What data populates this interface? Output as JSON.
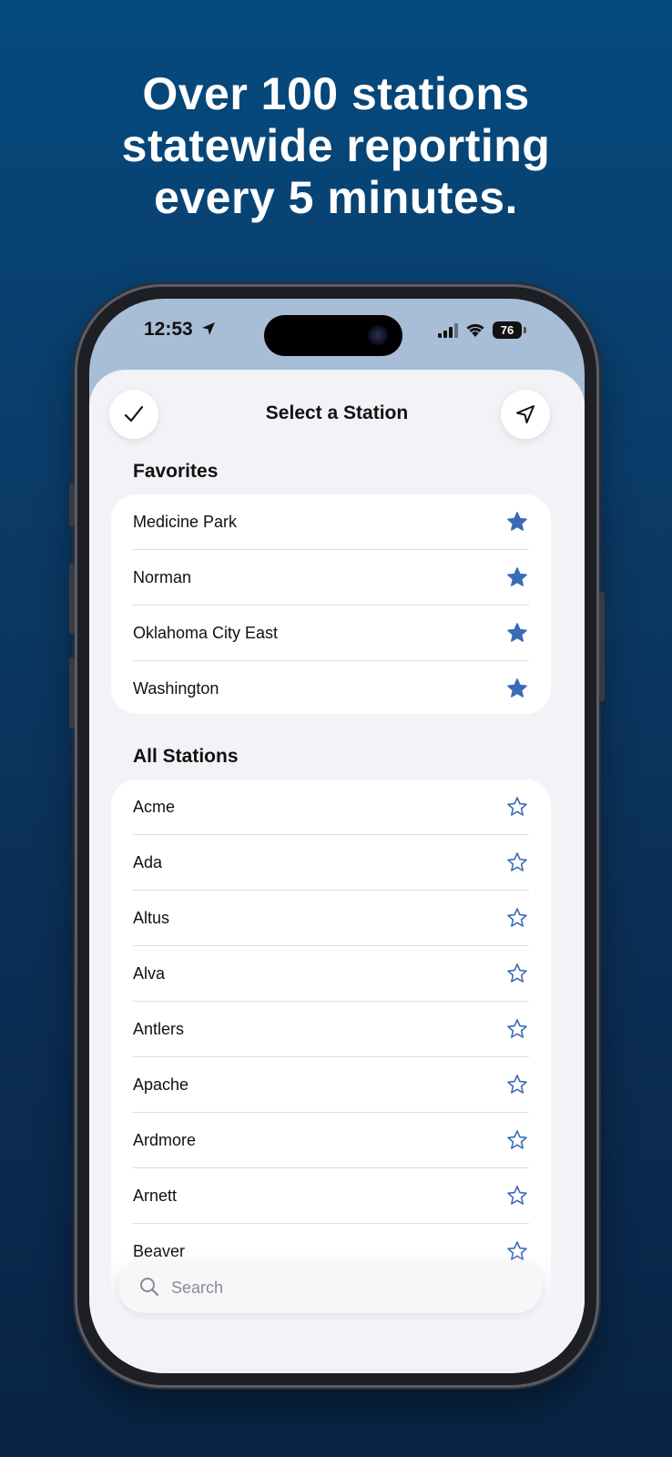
{
  "headline": {
    "line1": "Over 100 stations",
    "line2": "statewide reporting",
    "line3": "every 5 minutes."
  },
  "status_bar": {
    "time": "12:53",
    "battery": "76",
    "icons": [
      "location-arrow-icon",
      "signal-icon",
      "wifi-icon",
      "battery-icon"
    ]
  },
  "sheet": {
    "title": "Select a Station",
    "left_button_icon": "checkmark-icon",
    "right_button_icon": "location-arrow-icon"
  },
  "favorites": {
    "title": "Favorites",
    "items": [
      {
        "name": "Medicine Park",
        "favorited": true
      },
      {
        "name": "Norman",
        "favorited": true
      },
      {
        "name": "Oklahoma City East",
        "favorited": true
      },
      {
        "name": "Washington",
        "favorited": true
      }
    ]
  },
  "all_stations": {
    "title": "All Stations",
    "items": [
      {
        "name": "Acme",
        "favorited": false
      },
      {
        "name": "Ada",
        "favorited": false
      },
      {
        "name": "Altus",
        "favorited": false
      },
      {
        "name": "Alva",
        "favorited": false
      },
      {
        "name": "Antlers",
        "favorited": false
      },
      {
        "name": "Apache",
        "favorited": false
      },
      {
        "name": "Ardmore",
        "favorited": false
      },
      {
        "name": "Arnett",
        "favorited": false
      },
      {
        "name": "Beaver",
        "favorited": false
      }
    ]
  },
  "search": {
    "placeholder": "Search",
    "value": ""
  },
  "colors": {
    "star": "#3a6bb7",
    "background_top": "#054a7e",
    "background_bottom": "#082444",
    "status_bar_bg": "#a8bed6"
  }
}
